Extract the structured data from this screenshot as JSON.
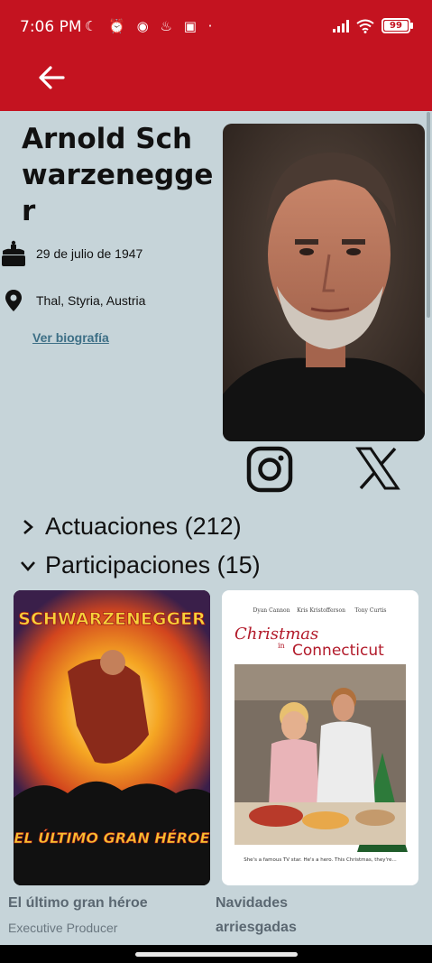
{
  "status_bar": {
    "time": "7:06 PM",
    "icons": "☾ ⏰ ◉ ♨ ▣ ·",
    "battery": "99"
  },
  "app_bar": {
    "back_icon": "arrow-left-icon",
    "color": "#c41320"
  },
  "person": {
    "name": "Arnold Schwarzenegger",
    "birth_date": "29 de julio de 1947",
    "birth_place": "Thal, Styria, Austria",
    "bio_link": "Ver biografía"
  },
  "social": [
    "instagram-icon",
    "x-icon"
  ],
  "sections": {
    "actuaciones": "Actuaciones (212)",
    "participaciones": "Participaciones (15)"
  },
  "movies": [
    {
      "title": "El último gran héroe",
      "role": "Executive Producer",
      "poster_top_text": "SCHWARZENEGGER",
      "poster_bottom_text": "EL ÚLTIMO GRAN HÉROE"
    },
    {
      "title": "Navidades arriesgadas",
      "role": "",
      "poster_credits": [
        "Dyan Cannon",
        "Kris Kristofferson",
        "Tony Curtis"
      ],
      "poster_title_1": "Christmas",
      "poster_title_2": "in",
      "poster_title_3": "Connecticut",
      "poster_bottom_text": "She's a famous TV star. He's a hero. This Christmas, they're..."
    }
  ]
}
